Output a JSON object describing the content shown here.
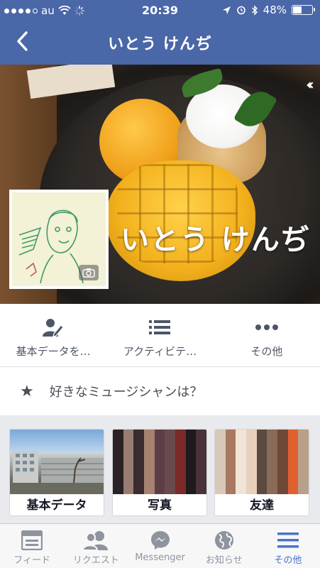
{
  "status_bar": {
    "carrier": "au",
    "time": "20:39",
    "battery_text": "48%",
    "battery_level": 0.48,
    "signal_dots_filled": 4
  },
  "nav": {
    "title": "いとう けんぢ"
  },
  "profile": {
    "cover_name": "いとう けんぢ"
  },
  "actions": [
    {
      "label": "基本データを…",
      "icon": "edit-profile-icon"
    },
    {
      "label": "アクティビテ…",
      "icon": "list-icon"
    },
    {
      "label": "その他",
      "icon": "more-icon"
    }
  ],
  "prompt": {
    "text": "好きなミュージシャンは？",
    "icon": "star-icon"
  },
  "tiles": [
    {
      "label": "基本データ"
    },
    {
      "label": "写真"
    },
    {
      "label": "友達"
    }
  ],
  "tabbar": [
    {
      "label": "フィード",
      "icon": "feed-icon",
      "active": false
    },
    {
      "label": "リクエスト",
      "icon": "friend-requests-icon",
      "active": false
    },
    {
      "label": "Messenger",
      "icon": "messenger-icon",
      "active": false
    },
    {
      "label": "お知らせ",
      "icon": "globe-icon",
      "active": false
    },
    {
      "label": "その他",
      "icon": "menu-icon",
      "active": true
    }
  ],
  "colors": {
    "brand_blue": "#4a67a8",
    "active_tab": "#4a74c9"
  }
}
